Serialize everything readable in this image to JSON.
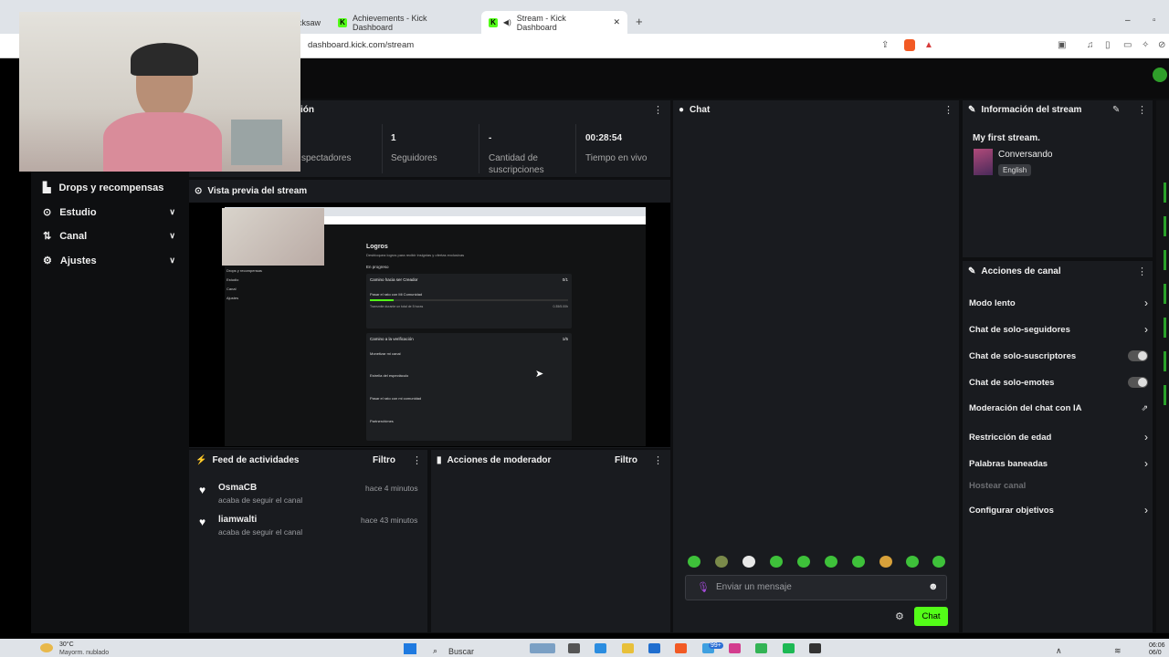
{
  "browser": {
    "tabs": [
      {
        "label": "cksaw"
      },
      {
        "label": "Achievements - Kick Dashboard"
      },
      {
        "label": "Stream - Kick Dashboard",
        "active": true
      }
    ],
    "close_glyph": "✕",
    "new_tab_glyph": "+",
    "url": "dashboard.kick.com/stream"
  },
  "sidebar": {
    "items": [
      {
        "label": "Drops y recompensas",
        "icon": "gift-icon"
      },
      {
        "label": "Estudio",
        "icon": "studio-icon"
      },
      {
        "label": "Canal",
        "icon": "channel-icon"
      },
      {
        "label": "Ajustes",
        "icon": "gear-icon"
      }
    ]
  },
  "session": {
    "title_partial": "ión",
    "stats": [
      {
        "value": "",
        "label": "spectadores"
      },
      {
        "value": "1",
        "label": "Seguidores"
      },
      {
        "value": "-",
        "label": "Cantidad de suscripciones"
      },
      {
        "value": "00:28:54",
        "label": "Tiempo en vivo"
      }
    ]
  },
  "preview": {
    "title": "Vista previa del stream"
  },
  "preview_screen": {
    "heading": "Logros",
    "sub": "Desbloquea logros para recibir insignias y ofertas exclusivas",
    "section": "En progreso",
    "card1_title": "Camino hacia ser Creador",
    "card1_count": "0/1",
    "card1_item": "Pasar el rato con Mi Comunidad",
    "card1_desc": "Transmite durante un total de 5 horas",
    "card1_val": "0.35/5.00h",
    "card2_title": "Camino a la verificación",
    "card2_count": "1/5",
    "card2_items": [
      "Monetizar mi canal",
      "Estrella del espectáculo",
      "Pasar el rato con mi comunidad",
      "Partnerchimes"
    ],
    "side": [
      "Drops y recompensas",
      "Estudio",
      "Canal",
      "Ajustes"
    ]
  },
  "feed": {
    "title": "Feed de actividades",
    "filter": "Filtro",
    "items": [
      {
        "user": "OsmaCB",
        "action": "acaba de seguir el canal",
        "time": "hace 4 minutos"
      },
      {
        "user": "liamwalti",
        "action": "acaba de seguir el canal",
        "time": "hace 43 minutos"
      }
    ]
  },
  "mod": {
    "title": "Acciones de moderador",
    "filter": "Filtro"
  },
  "chat": {
    "title": "Chat",
    "placeholder": "Enviar un mensaje",
    "send": "Chat"
  },
  "info": {
    "title": "Información del stream",
    "stream_title": "My first stream.",
    "category": "Conversando",
    "language": "English"
  },
  "channel_actions": {
    "title": "Acciones de canal",
    "rows": [
      {
        "label": "Modo lento",
        "control": "chevron"
      },
      {
        "label": "Chat de solo-seguidores",
        "control": "chevron"
      },
      {
        "label": "Chat de solo-suscriptores",
        "control": "toggle"
      },
      {
        "label": "Chat de solo-emotes",
        "control": "toggle"
      },
      {
        "label": "Moderación del chat con IA",
        "control": "external"
      },
      {
        "label": "Restricción de edad",
        "control": "chevron"
      },
      {
        "label": "Palabras baneadas",
        "control": "chevron"
      },
      {
        "label": "Hostear canal",
        "control": "none",
        "disabled": true
      },
      {
        "label": "Configurar objetivos",
        "control": "chevron"
      }
    ]
  },
  "taskbar": {
    "weather_temp": "30°C",
    "weather_desc": "Mayorm. nublado",
    "search": "Buscar",
    "badge": "99+",
    "time": "06:06",
    "date": "06/0"
  },
  "colors": {
    "kick_green": "#53fc18",
    "panel": "#191b1f"
  }
}
